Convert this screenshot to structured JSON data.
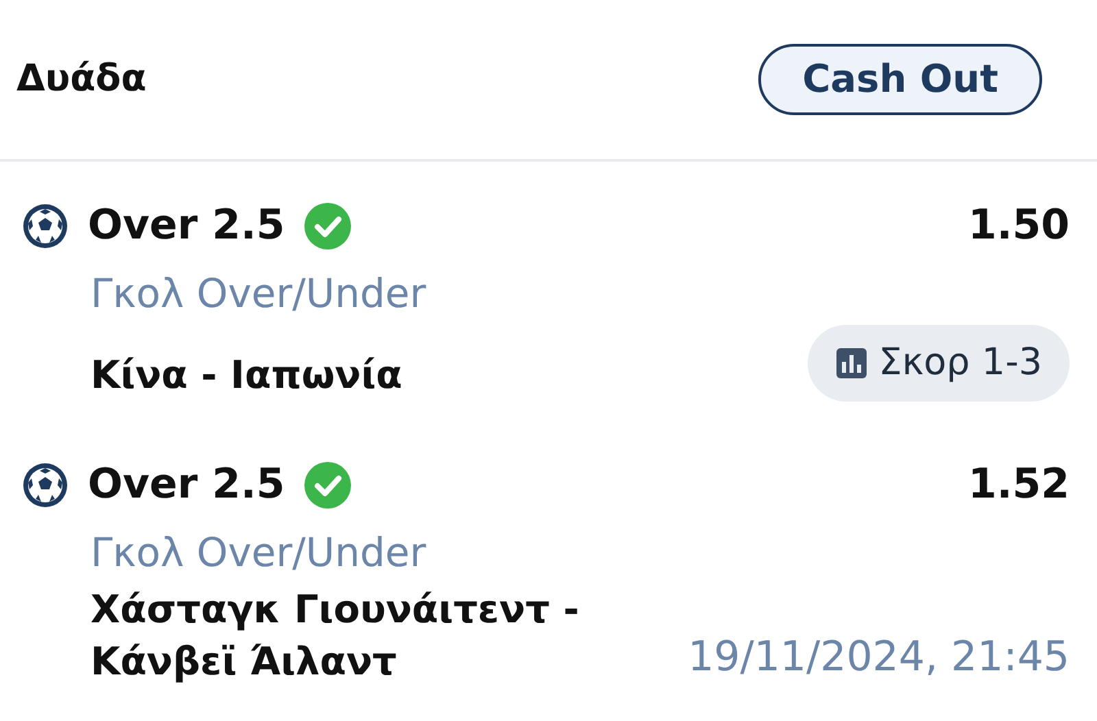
{
  "header": {
    "title": "Δυάδα",
    "cash_out_button": "Cash Out"
  },
  "bets": [
    {
      "selection": "Over 2.5",
      "won": true,
      "odds": "1.50",
      "market": "Γκολ Over/Under",
      "match": "Κίνα - Ιαπωνία",
      "extra": {
        "kind": "score",
        "text": "Σκορ 1-3"
      }
    },
    {
      "selection": "Over 2.5",
      "won": true,
      "odds": "1.52",
      "market": "Γκολ Over/Under",
      "match": "Χάσταγκ Γιουνάιτεντ - Κάνβεϊ Άιλαντ",
      "extra": {
        "kind": "date",
        "text": "19/11/2024, 21:45"
      }
    }
  ]
}
